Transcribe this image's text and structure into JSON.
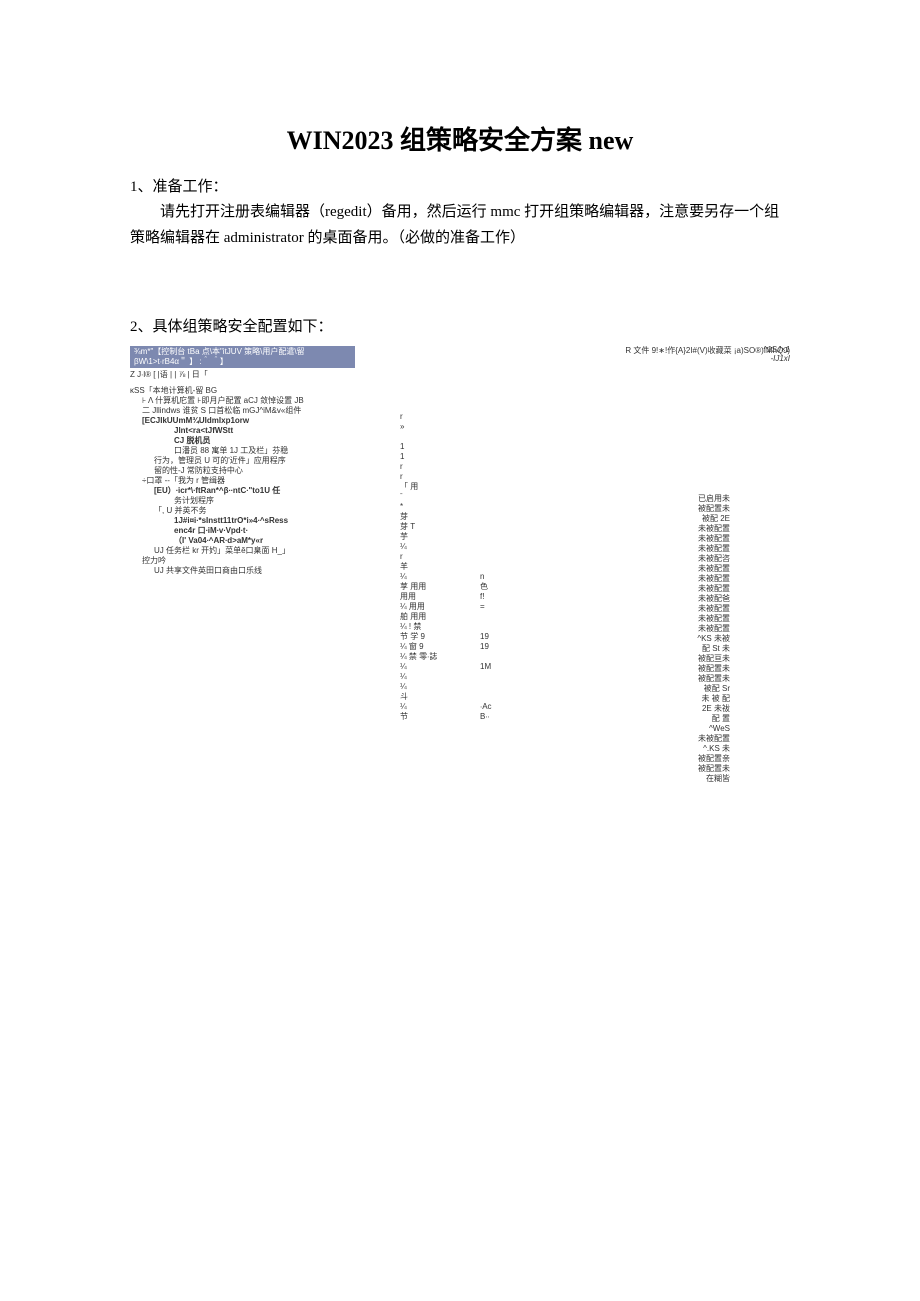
{
  "title": "WIN2023 组策略安全方案 new",
  "section1": {
    "heading": "1、准备工作：",
    "paragraph": "请先打开注册表编辑器（regedit）备用，然后运行 mmc 打开组策略编辑器，注意要另存一个组策略编辑器在 administrator 的桌面备用。（必做的准备工作）"
  },
  "section2": {
    "heading": "2、具体组策略安全配置如下："
  },
  "screenshot": {
    "titlebar": "¾m*\"【控制台 tBa 点\\本\"itJUV 策略\\用户配遣\\留 βW\\1>t∙rB4α＂ 】 :＾ ＾】",
    "topright": [
      "^1SJ×1",
      "-IJ1xI"
    ],
    "filebar": "R 文件 9!∗!作{A}2I#(V)收藏菜 ¡a)SO®)IMhQJ)",
    "toolbar": "Z J∙l® [ |语 | | ⅞ | 日「",
    "tree": [
      {
        "cls": "",
        "t": "κSS「本地计算机-留 BG"
      },
      {
        "cls": "ind1",
        "t": "⊦ Λ 什算机庀置 ⊦即月户配置 aCJ 敛悼设置 JB"
      },
      {
        "cls": "ind1",
        "t": "二 Jllindws 谁贫 S 口首松临 mGJ^iM&v«组件"
      },
      {
        "cls": "ind1 b",
        "t": "[ECJIkUUmM¾UIdmIxp1orw"
      },
      {
        "cls": "ind3 b",
        "t": "Jlnt<ra<tJfWStt"
      },
      {
        "cls": "ind3 b",
        "t": "CJ 脱机员"
      },
      {
        "cls": "ind3",
        "t": "口潘员 88 寓单 1J 工及栏」芬稳"
      },
      {
        "cls": "ind2",
        "t": "行为，管理员 U 可的'近件」应用程序"
      },
      {
        "cls": "ind2",
        "t": "留的性-J 常防粒支持中心"
      },
      {
        "cls": "ind1",
        "t": "÷口罩 --「我为 r 管缉器"
      },
      {
        "cls": "ind2 b",
        "t": "[EU）∙icr*\\∙ftRan*^β∙∙ntC∙\"to1U 任"
      },
      {
        "cls": "ind3",
        "t": "务计划程序"
      },
      {
        "cls": "ind2",
        "t": "「, U 并英不务"
      },
      {
        "cls": "ind3 b",
        "t": "1J#i¤i∙*sInstt11trO*i»4∙^sRess"
      },
      {
        "cls": "ind3 b",
        "t": "enc4r 口∙iM∙v∙Vpd∙t∙"
      },
      {
        "cls": "ind3 b",
        "t": "（I'   Va04∙^AR∙d>aM*y«r"
      },
      {
        "cls": "ind2",
        "t": "UJ 任务栏 kr 开妁」菜单ĕ口臬面 H_」"
      },
      {
        "cls": "ind1",
        "t": "控力吟"
      },
      {
        "cls": "ind2",
        "t": "UJ 共享文件英田口商由口乐线"
      }
    ],
    "mid": [
      {
        "a": "r",
        "b": ""
      },
      {
        "a": "»",
        "b": ""
      },
      {
        "a": "",
        "b": ""
      },
      {
        "a": "1",
        "b": ""
      },
      {
        "a": "1",
        "b": ""
      },
      {
        "a": "r",
        "b": ""
      },
      {
        "a": "r",
        "b": ""
      },
      {
        "a": "「   用",
        "b": ""
      },
      {
        "a": "     ˉ",
        "b": ""
      },
      {
        "a": "*",
        "b": ""
      },
      {
        "a": "芽",
        "b": ""
      },
      {
        "a": "芽        T",
        "b": ""
      },
      {
        "a": "芋",
        "b": ""
      },
      {
        "a": "¼",
        "b": ""
      },
      {
        "a": "r",
        "b": ""
      },
      {
        "a": "羊",
        "b": ""
      },
      {
        "a": "¼",
        "b": "n"
      },
      {
        "a": "莩 用用",
        "b": "色"
      },
      {
        "a": "    用用",
        "b": "f!"
      },
      {
        "a": "¼ 用用",
        "b": "="
      },
      {
        "a": "舶 用用",
        "b": ""
      },
      {
        "a": "¼ ! 禁",
        "b": ""
      },
      {
        "a": "节 学 9",
        "b": "19"
      },
      {
        "a": "¼ 窗 9",
        "b": "19"
      },
      {
        "a": "¼ 禁 零∙誌",
        "b": ""
      },
      {
        "a": "¼",
        "b": "1M"
      },
      {
        "a": "¼",
        "b": ""
      },
      {
        "a": "¼",
        "b": ""
      },
      {
        "a": "斗",
        "b": ""
      },
      {
        "a": "¼",
        "b": "∙Ac"
      },
      {
        "a": "节",
        "b": "B∙∙"
      }
    ],
    "right": [
      "已启用未",
      "被配置未",
      "被配 2E",
      "未被配置",
      "未被配置",
      "未被配置",
      "未被配咨",
      "未被配置",
      "未被配置",
      "未被配置",
      "未被配爸",
      "未被配置",
      "未被配置",
      "未被配置",
      "^KS 未被",
      "配 St 未",
      "被配亘未",
      "被配置未",
      "被配置未",
      "被配 Sr",
      "未 被 配",
      "2E 未祓",
      "配      置",
      "^WeS",
      "未被配置",
      "^.KS  未",
      "被配置亲",
      "被配置未",
      "在糊皆"
    ]
  }
}
